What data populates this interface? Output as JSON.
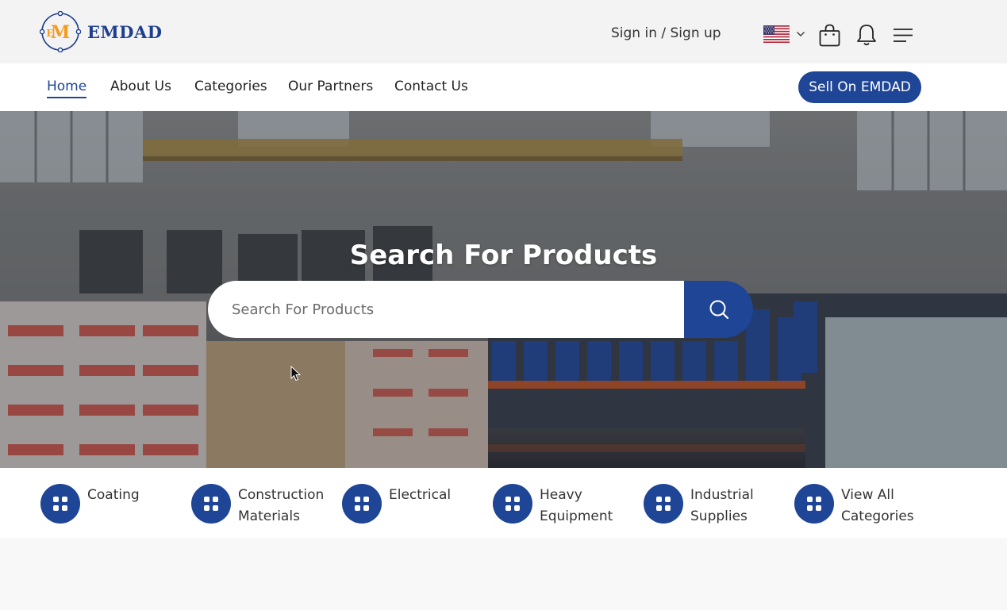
{
  "brand": {
    "name": "EMDAD",
    "mark_letters": "EM"
  },
  "header": {
    "signin_label": "Sign in / Sign up",
    "language_flag": "us-flag-icon",
    "icons": [
      "cart-icon",
      "bell-icon",
      "menu-icon"
    ]
  },
  "nav": {
    "items": [
      {
        "label": "Home",
        "active": true
      },
      {
        "label": "About Us",
        "active": false
      },
      {
        "label": "Categories",
        "active": false
      },
      {
        "label": "Our Partners",
        "active": false
      },
      {
        "label": "Contact Us",
        "active": false
      }
    ],
    "cta_label": "Sell On EMDAD"
  },
  "hero": {
    "title": "Search For Products",
    "search_placeholder": "Search For Products"
  },
  "categories": [
    {
      "label": "Coating"
    },
    {
      "label": "Construction Materials"
    },
    {
      "label": "Electrical"
    },
    {
      "label": "Heavy Equipment"
    },
    {
      "label": "Industrial Supplies"
    },
    {
      "label": "View All Categories"
    }
  ],
  "colors": {
    "primary": "#1e4596",
    "accent": "#f39c1f",
    "topbar_bg": "#f3f3f3"
  }
}
